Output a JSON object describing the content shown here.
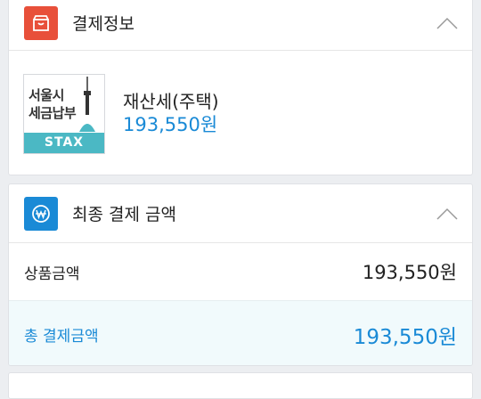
{
  "payment_info": {
    "title": "결제정보",
    "icon": "shopping-bag-icon",
    "icon_color": "#e8503a",
    "item": {
      "thumb_line1": "서울시",
      "thumb_line2": "세금납부",
      "thumb_brand": "STAX",
      "name": "재산세(주택)",
      "price": "193,550원"
    }
  },
  "final_amount": {
    "title": "최종 결제 금액",
    "icon": "won-icon",
    "icon_color": "#1a8ad6",
    "product_label": "상품금액",
    "product_value": "193,550원",
    "total_label": "총 결제금액",
    "total_value": "193,550원"
  },
  "colors": {
    "accent": "#1a8ad6",
    "background": "#eceef1"
  }
}
